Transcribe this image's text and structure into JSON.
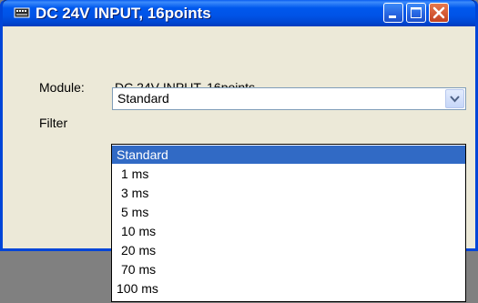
{
  "window": {
    "title": "DC 24V INPUT, 16points",
    "accent": "#0054e3",
    "close_color": "#d35834"
  },
  "form": {
    "module_label": "Module:",
    "module_value": "DC 24V INPUT, 16points",
    "filter_label": "Filter",
    "filter_value": "Standard"
  },
  "dropdown": {
    "options": [
      "Standard",
      "1 ms",
      "3 ms",
      "5 ms",
      "10 ms",
      "20 ms",
      "70 ms",
      "100 ms"
    ],
    "selected": "Standard",
    "highlight_color": "#316ac5"
  }
}
